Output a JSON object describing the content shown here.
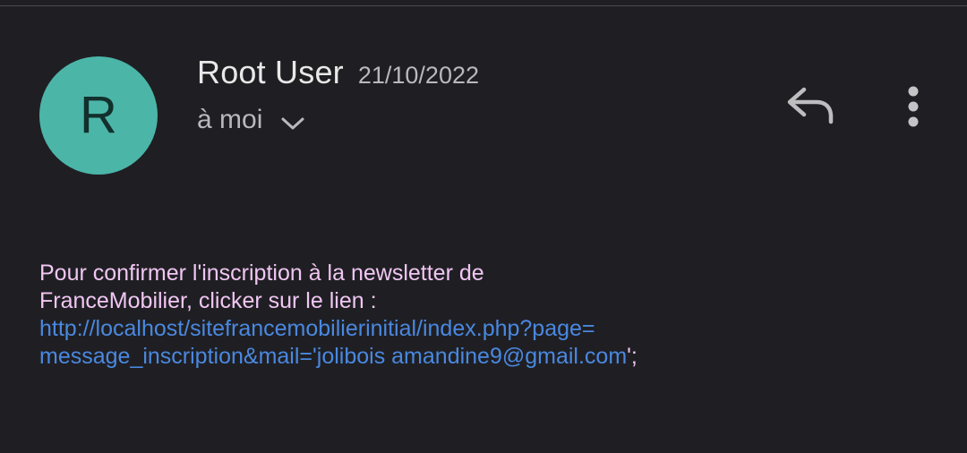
{
  "header": {
    "avatar_letter": "R",
    "sender_name": "Root User",
    "date": "21/10/2022",
    "recipient": "à moi"
  },
  "icons": {
    "reply": "reply-icon",
    "more": "more-vert-icon",
    "expand": "chevron-down-icon"
  },
  "message": {
    "line1": "Pour confirmer l'inscription à la newsletter de",
    "line2": "FranceMobilier, clicker sur le lien :",
    "link_line1": " http://localhost/sitefrancemobilierinitial/index.php?page=",
    "link_line2": "message_inscription&mail='jolibois amandine9@gmail.com",
    "tail": "';"
  },
  "colors": {
    "background": "#1f1f23",
    "avatar": "#4bb5a8",
    "body_text": "#f1c6f3",
    "link": "#4a88e0"
  }
}
